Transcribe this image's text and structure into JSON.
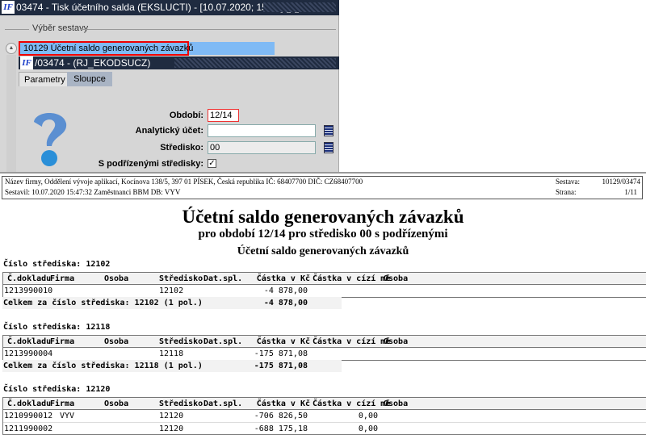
{
  "window": {
    "title": "03474 - Tisk účetního salda (EKSLUCTI) - [10.07.2020; 15:44] [] []",
    "logo": "IF",
    "group_label": "Výběr sestavy",
    "selected_report": "10129  Účetní saldo generovaných závazků",
    "subwindow_title": "/03474 - (RJ_EKODSUCZ)",
    "tabs": [
      {
        "label": "Parametry"
      },
      {
        "label": "Sloupce"
      }
    ],
    "fields": {
      "obdobi_label": "Období:",
      "obdobi_value": "12/14",
      "analyticky_label": "Analytický účet:",
      "analyticky_value": "",
      "stredisko_label": "Středisko:",
      "stredisko_value": "00",
      "podrizene_label": "S podřízenými středisky:",
      "podrizene_checked": true
    }
  },
  "report": {
    "header_left1": "Název firmy, Oddělení vývoje aplikací, Kocínova 138/5, 397 01 PÍSEK, Česká republika  IČ: 68407700  DIČ: CZ68407700",
    "header_left2": "Sestavil: 10.07.2020 15:47:32 Zaměstnanci BBM  DB: VYV",
    "sestava_label": "Sestava:",
    "sestava_value": "10129/03474",
    "strana_label": "Strana:",
    "strana_value": "1/11",
    "title": "Účetní saldo generovaných závazků",
    "subtitle": "pro období 12/14 pro středisko 00 s podřízenými",
    "subtitle2": "Účetní saldo generovaných závazků",
    "columns": [
      "Č.dokladu",
      "Firma",
      "Osoba",
      "Středisko",
      "Dat.spl.",
      "Částka v Kč",
      "Částka v cízí mě",
      "Osoba"
    ],
    "sections": [
      {
        "title": "Číslo střediska: 12102",
        "rows": [
          {
            "doklad": "1213990010",
            "firma": "",
            "stredisko": "12102",
            "castka": "-4 878,00",
            "cizi": ""
          }
        ],
        "total_label": "Celkem za číslo střediska: 12102 (1 pol.)",
        "total": "-4 878,00"
      },
      {
        "title": "Číslo střediska: 12118",
        "rows": [
          {
            "doklad": "1213990004",
            "firma": "",
            "stredisko": "12118",
            "castka": "-175 871,08",
            "cizi": ""
          }
        ],
        "total_label": "Celkem za číslo střediska: 12118 (1 pol.)",
        "total": "-175 871,08"
      },
      {
        "title": "Číslo střediska: 12120",
        "rows": [
          {
            "doklad": "1210990012",
            "firma": "VYV",
            "stredisko": "12120",
            "castka": "-706 826,50",
            "cizi": "0,00"
          },
          {
            "doklad": "1211990002",
            "firma": "",
            "stredisko": "12120",
            "castka": "-688 175,18",
            "cizi": "0,00"
          }
        ]
      }
    ]
  }
}
